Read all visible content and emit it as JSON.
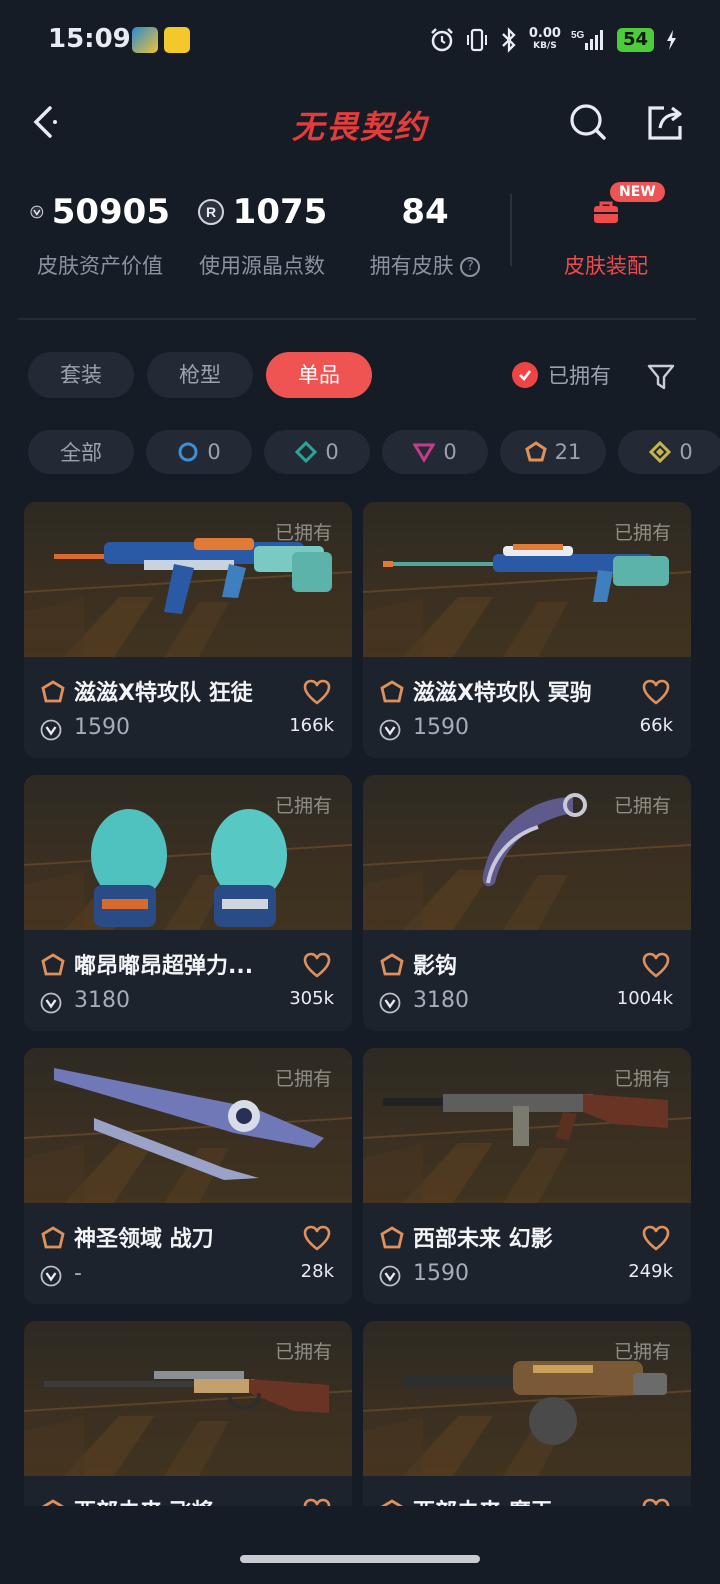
{
  "status_bar": {
    "time": "15:09",
    "net_speed_value": "0.00",
    "net_speed_unit": "KB/S",
    "network": "5G",
    "battery": "54",
    "icons": [
      "alarm-icon",
      "vibrate-icon",
      "bluetooth-icon",
      "signal-icon",
      "charging-icon"
    ]
  },
  "header": {
    "title": "无畏契约",
    "accent_color": "#e43b3b"
  },
  "stats": {
    "asset_value": "50905",
    "asset_label": "皮肤资产价值",
    "radianite_points": "1075",
    "radianite_label": "使用源晶点数",
    "owned_skins": "84",
    "owned_label": "拥有皮肤",
    "loadout_label": "皮肤装配",
    "new_badge": "NEW"
  },
  "tabs": [
    {
      "label": "套装",
      "active": false
    },
    {
      "label": "枪型",
      "active": false
    },
    {
      "label": "单品",
      "active": true
    }
  ],
  "owned_filter_label": "已拥有",
  "tiers": [
    {
      "label": "全部",
      "count": ""
    },
    {
      "count": "0",
      "color": "#3f8fd6",
      "icon": "select-tier-icon"
    },
    {
      "count": "0",
      "color": "#2aa59a",
      "icon": "deluxe-tier-icon"
    },
    {
      "count": "0",
      "color": "#c43c8c",
      "icon": "premium-tier-icon"
    },
    {
      "count": "21",
      "color": "#e0905a",
      "icon": "exclusive-tier-icon"
    },
    {
      "count": "0",
      "color": "#c9b34a",
      "icon": "ultra-tier-icon"
    }
  ],
  "owned_tag": "已拥有",
  "items": [
    {
      "name": "滋滋X特攻队 狂徒",
      "price": "1590",
      "likes": "166k",
      "weapon": "rifle-skin"
    },
    {
      "name": "滋滋X特攻队 冥驹",
      "price": "1590",
      "likes": "66k",
      "weapon": "sniper-skin"
    },
    {
      "name": "嘟昂嘟昂超弹力...",
      "price": "3180",
      "likes": "305k",
      "weapon": "gloves-skin"
    },
    {
      "name": "影钩",
      "price": "3180",
      "likes": "1004k",
      "weapon": "karambit-skin"
    },
    {
      "name": "神圣领域 战刀",
      "price": "-",
      "likes": "28k",
      "weapon": "blade-skin"
    },
    {
      "name": "西部未来 幻影",
      "price": "1590",
      "likes": "249k",
      "weapon": "western-rifle-skin"
    },
    {
      "name": "西部未来 飞将",
      "price": "",
      "likes": "",
      "weapon": "lever-rifle-skin"
    },
    {
      "name": "西部未来 魔王",
      "price": "",
      "likes": "",
      "weapon": "minigun-skin"
    }
  ]
}
